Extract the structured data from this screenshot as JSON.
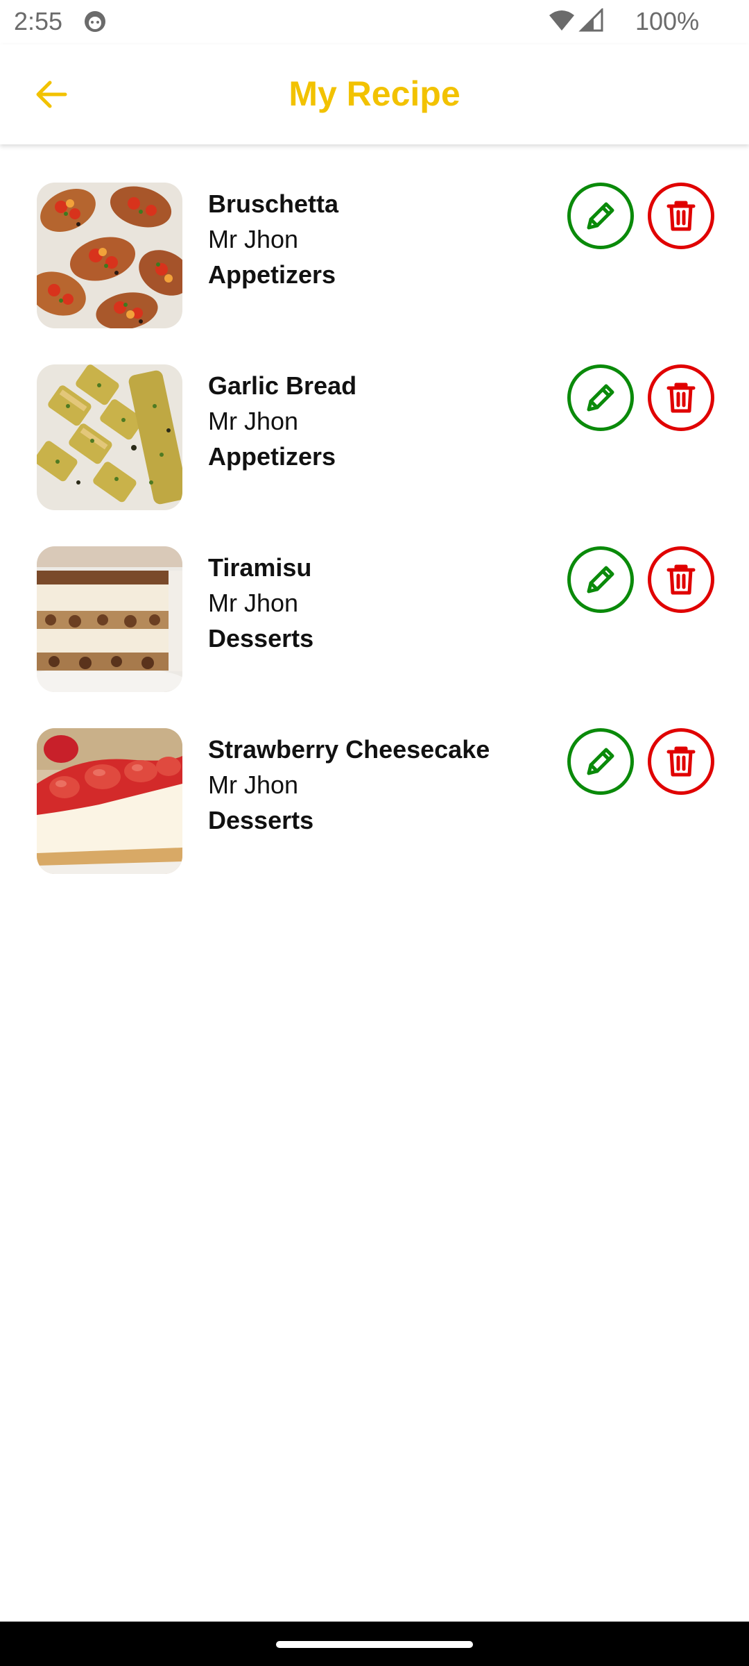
{
  "status_bar": {
    "time": "2:55",
    "battery": "100%"
  },
  "header": {
    "title": "My Recipe"
  },
  "colors": {
    "accent": "#f2c200",
    "edit": "#0a8a0a",
    "delete": "#e00000"
  },
  "recipes": [
    {
      "name": "Bruschetta",
      "author": "Mr Jhon",
      "category": "Appetizers"
    },
    {
      "name": "Garlic Bread",
      "author": "Mr Jhon",
      "category": "Appetizers"
    },
    {
      "name": "Tiramisu",
      "author": "Mr Jhon",
      "category": "Desserts"
    },
    {
      "name": "Strawberry Cheesecake",
      "author": "Mr Jhon",
      "category": "Desserts"
    }
  ]
}
